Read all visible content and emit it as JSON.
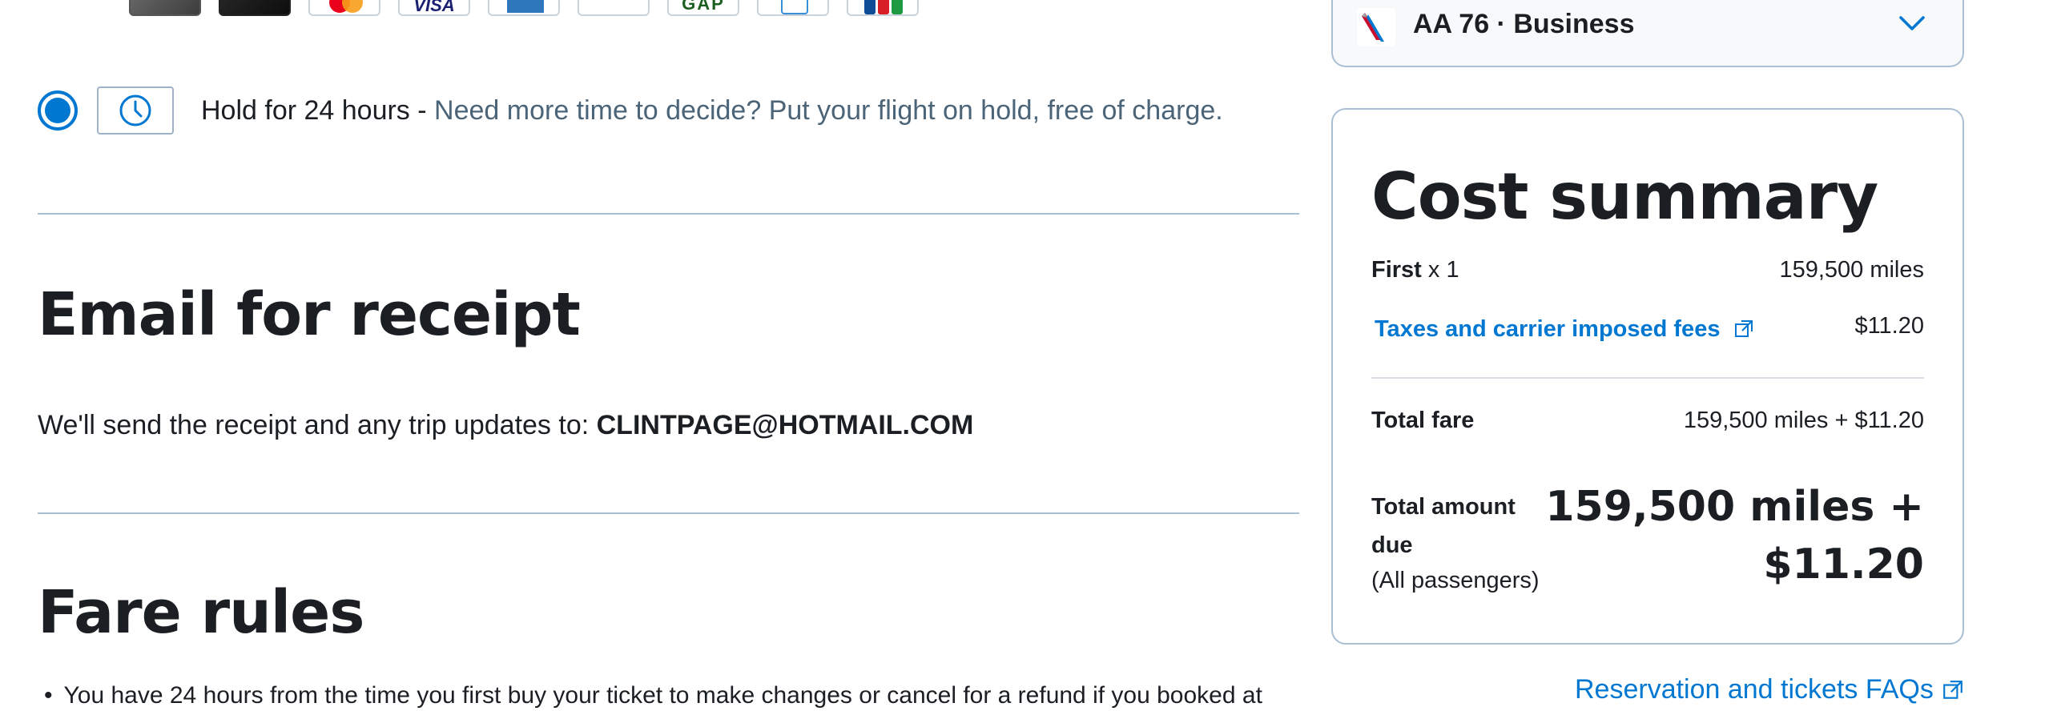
{
  "payment_cards": {
    "icons": [
      "card-icon",
      "card-icon",
      "mastercard-icon",
      "visa-icon",
      "amex-icon",
      "card-icon",
      "gap-card-icon",
      "card-icon",
      "jcb-card-icon"
    ],
    "visa_text": "VISA",
    "gap_text": "GAP"
  },
  "hold": {
    "label": "Hold for 24 hours - ",
    "description": "Need more time to decide? Put your flight on hold, free of charge.",
    "selected": true
  },
  "email_section": {
    "title": "Email for receipt",
    "text": "We'll send the receipt and any trip updates to: ",
    "email": "CLINTPAGE@HOTMAIL.COM"
  },
  "fare_rules": {
    "title": "Fare rules",
    "bullet": "You have 24 hours from the time you first buy your ticket to make changes or cancel for a refund if you booked at"
  },
  "flight": {
    "label": "AA 76 · Business"
  },
  "cost_summary": {
    "title": "Cost summary",
    "first_label": "First",
    "first_qty": " x 1",
    "first_value": "159,500 miles",
    "taxes_label": "Taxes and carrier imposed fees",
    "taxes_value": "$11.20",
    "total_fare_label": "Total fare",
    "total_fare_value": "159,500 miles + $11.20",
    "total_due_label_1": "Total amount",
    "total_due_label_2": "due",
    "total_due_sub": "(All passengers)",
    "total_due_value_1": "159,500 miles +",
    "total_due_value_2": "$11.20"
  },
  "faq_link": "Reservation and tickets FAQs",
  "colors": {
    "accent": "#0078d2",
    "text": "#1b1f23",
    "muted": "#4b6478",
    "border": "#a9bfd4"
  }
}
